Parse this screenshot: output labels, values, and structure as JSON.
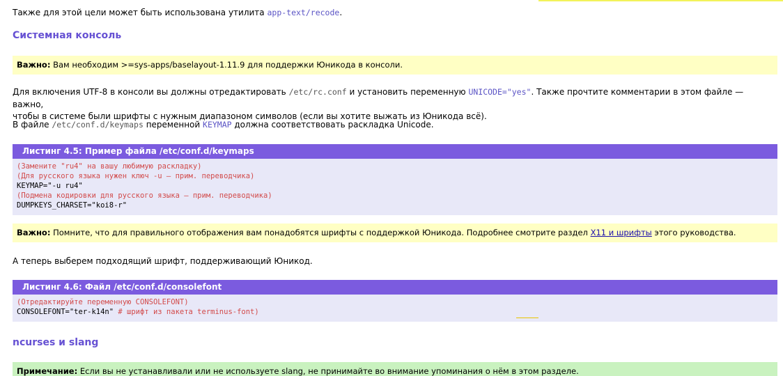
{
  "intro": {
    "text": "Также для этой цели может быть использована утилита ",
    "package": "app-text/recode",
    "end": "."
  },
  "section_console": {
    "title": "Системная консоль"
  },
  "note1": {
    "label": "Важно:",
    "text": " Вам необходим >=sys-apps/baselayout-1.11.9 для поддержки Юникода в консоли."
  },
  "para1": {
    "t1": "Для включения UTF-8 в консоли вы должны отредактировать ",
    "file": "/etc/rc.conf",
    "t2": " и установить переменную ",
    "var": "UNICODE=\"yes\"",
    "t3": ". Также прочтите комментарии в этом файле — важно,",
    "line2": "чтобы в системе были шрифты с нужным диапазоном символов (если вы хотите выжать из Юникода всё)."
  },
  "para2": {
    "t1": "В файле ",
    "file": "/etc/conf.d/keymaps",
    "t2": " переменной ",
    "var": "KEYMAP",
    "t3": " должна соответствовать раскладка Unicode."
  },
  "listing5": {
    "title": "Листинг 4.5: Пример файла /etc/conf.d/keymaps",
    "lines": [
      {
        "text": "(Замените \"ru4\" на вашу любимую раскладку)",
        "comment": true
      },
      {
        "text": "(Для русского языка нужен ключ -u — прим. переводчика)",
        "comment": true
      },
      {
        "text": "KEYMAP=\"-u ru4\"",
        "comment": false
      },
      {
        "text": "(Подмена кодировки для русского языка — прим. переводчика)",
        "comment": true
      },
      {
        "text": "DUMPKEYS_CHARSET=\"koi8-r\"",
        "comment": false
      }
    ]
  },
  "note2": {
    "label": "Важно:",
    "text": " Помните, что для правильного отображения вам понадобятся шрифты с поддержкой Юникода. Подробнее смотрите раздел ",
    "link": "X11 и шрифты",
    "end": " этого руководства."
  },
  "para3": {
    "text": "А теперь выберем подходящий шрифт, поддерживающий Юникод."
  },
  "listing6": {
    "title": "Листинг 4.6: Файл /etc/conf.d/consolefont",
    "line1": "(Отредактируйте переменную CONSOLEFONT)",
    "line2_code": "CONSOLEFONT=\"ter-k14n\"",
    "line2_comment": " # шрифт из пакета terminus-font)"
  },
  "section_ncurses": {
    "title": "ncurses и slang"
  },
  "note3": {
    "label": "Примечание:",
    "text": " Если вы не устанавливали или не используете slang, не принимайте во внимание упоминания о нём в этом разделе."
  }
}
